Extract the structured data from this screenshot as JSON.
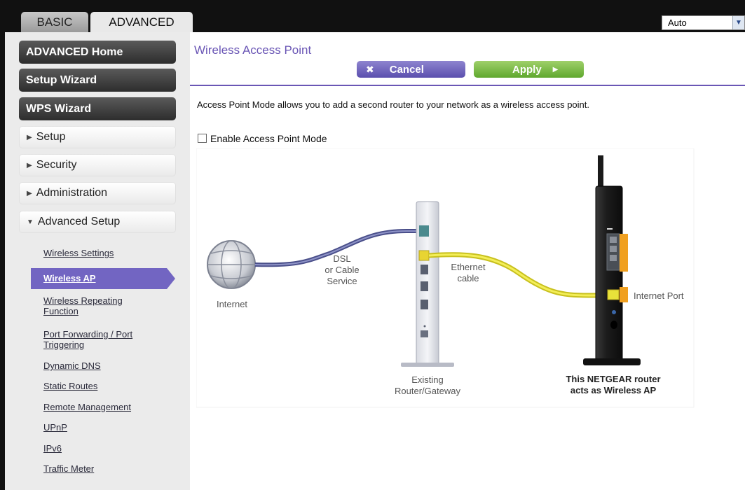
{
  "header": {
    "tabs": [
      {
        "label": "BASIC"
      },
      {
        "label": "ADVANCED"
      }
    ],
    "language_select": {
      "value": "Auto"
    }
  },
  "sidebar": {
    "primary": [
      {
        "label": "ADVANCED Home"
      },
      {
        "label": "Setup Wizard"
      },
      {
        "label": "WPS Wizard"
      }
    ],
    "sections": [
      {
        "label": "Setup"
      },
      {
        "label": "Security"
      },
      {
        "label": "Administration"
      },
      {
        "label": "Advanced Setup"
      }
    ],
    "subitems": [
      {
        "label": "Wireless Settings"
      },
      {
        "label": "Wireless AP"
      },
      {
        "label": "Wireless Repeating Function"
      },
      {
        "label": "Port Forwarding / Port Triggering"
      },
      {
        "label": "Dynamic DNS"
      },
      {
        "label": "Static Routes"
      },
      {
        "label": "Remote Management"
      },
      {
        "label": "UPnP"
      },
      {
        "label": "IPv6"
      },
      {
        "label": "Traffic Meter"
      }
    ],
    "active_subitem": "Wireless AP"
  },
  "main": {
    "title": "Wireless Access Point",
    "cancel_label": "Cancel",
    "apply_label": "Apply",
    "intro": "Access Point Mode allows you to add a second router to your network as a wireless access point.",
    "checkbox_label": "Enable Access Point Mode",
    "checkbox_checked": false
  },
  "diagram": {
    "internet": "Internet",
    "dsl_line1": "DSL",
    "dsl_line2": "or Cable",
    "dsl_line3": "Service",
    "ethernet_line1": "Ethernet",
    "ethernet_line2": "cable",
    "internet_port": "Internet Port",
    "existing_line1": "Existing",
    "existing_line2": "Router/Gateway",
    "netgear_line1": "This NETGEAR router",
    "netgear_line2": "acts as Wireless AP"
  },
  "colors": {
    "accent_purple": "#6a56b5",
    "apply_green": "#6fb53a",
    "cable_yellow": "#e8e23a",
    "cable_blue": "#4a4f8a",
    "router_orange": "#f0a020"
  }
}
